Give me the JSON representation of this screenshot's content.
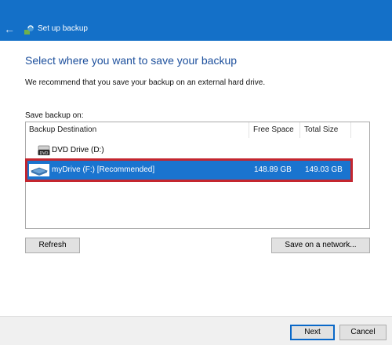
{
  "window": {
    "title": "Set up backup",
    "back_icon": "back-arrow-icon",
    "app_icon": "backup-app-icon"
  },
  "content": {
    "heading": "Select where you want to save your backup",
    "recommendation": "We recommend that you save your backup on an external hard drive.",
    "save_backup_on_label": "Save backup on:"
  },
  "table": {
    "columns": {
      "destination": "Backup Destination",
      "free_space": "Free Space",
      "total_size": "Total Size"
    },
    "rows": [
      {
        "icon": "dvd-drive-icon",
        "name": "DVD Drive (D:)",
        "free_space": "",
        "total_size": "",
        "selected": false
      },
      {
        "icon": "external-drive-icon",
        "name": "myDrive (F:) [Recommended]",
        "free_space": "148.89 GB",
        "total_size": "149.03 GB",
        "selected": true
      }
    ]
  },
  "buttons": {
    "refresh": "Refresh",
    "save_on_network": "Save on a network...",
    "next": "Next",
    "cancel": "Cancel"
  },
  "colors": {
    "titlebar": "#1470c8",
    "heading": "#1c4f9c",
    "selection": "#1a74cf",
    "highlight_border": "#c4262f"
  }
}
